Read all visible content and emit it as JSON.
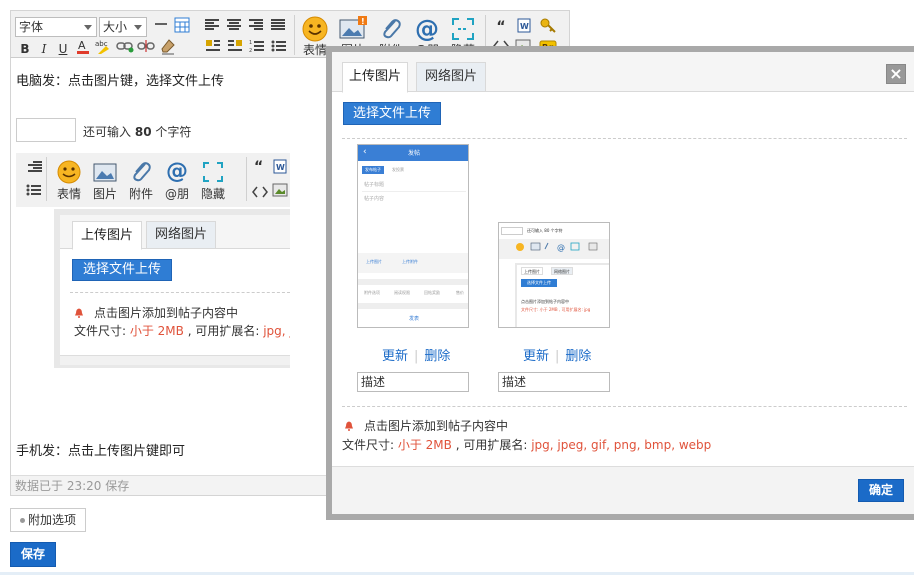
{
  "toolbar": {
    "font_select": "字体",
    "size_select": "大小",
    "big_buttons": [
      "表情",
      "图片",
      "附件",
      "@朋",
      "隐藏"
    ]
  },
  "editor": {
    "line1": "电脑发：点击图片键，选择文件上传",
    "count_prefix": "还可输入",
    "count_value": "80",
    "count_suffix": "个字符",
    "line2": "手机发：点击上传图片键即可",
    "status": "数据已于 23:20 保存"
  },
  "inner_shot": {
    "buttons": [
      "表情",
      "图片",
      "附件",
      "@朋",
      "隐藏"
    ],
    "tab_upload": "上传图片",
    "tab_network": "网络图片",
    "select_button": "选择文件上传",
    "hint": "点击图片添加到帖子内容中",
    "size_prefix": "文件尺寸: ",
    "size_value": "小于 2MB",
    "ext_prefix": " , 可用扩展名: ",
    "ext_value": "jpg, jp"
  },
  "actions": {
    "add_option": "附加选项",
    "save": "保存"
  },
  "dialog": {
    "tab_upload": "上传图片",
    "tab_network": "网络图片",
    "close": "×",
    "select_button": "选择文件上传",
    "images": [
      {
        "update": "更新",
        "delete": "删除",
        "desc": "描述"
      },
      {
        "update": "更新",
        "delete": "删除",
        "desc": "描述"
      }
    ],
    "thumb1": {
      "header": "发帖",
      "tab_a": "发布帖子",
      "tab_b": "发投票",
      "title_ph": "帖子标题",
      "content_ph": "帖子内容",
      "btn_img": "上传图片",
      "btn_att": "上传附件",
      "opt1": "附件选项",
      "opt2": "阅读权限",
      "opt3": "回帖奖励",
      "opt4": "售价",
      "post": "发表"
    },
    "thumb2": {
      "count": "还可输入 80 个字符",
      "tab_a": "上传图片",
      "tab_b": "网络图片",
      "btn": "选择文件上传",
      "hint": "点击图片添加到帖子内容中",
      "size": "文件尺寸: 小于 2MB , 可用扩展名: jpg"
    },
    "hint": "点击图片添加到帖子内容中",
    "size_prefix": "文件尺寸: ",
    "size_value": "小于 2MB",
    "ext_prefix": " , 可用扩展名: ",
    "ext_value": "jpg, jpeg, gif, png, bmp, webp",
    "ok": "确定"
  },
  "colors": {
    "accent": "#2f7dd4",
    "warning_text": "#e0533b"
  }
}
